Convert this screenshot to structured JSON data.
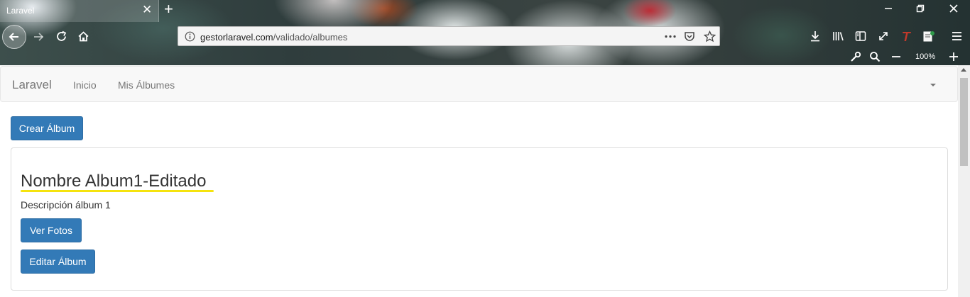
{
  "browser": {
    "tab_title": "Laravel",
    "url_domain": "gestorlaravel.com",
    "url_path": "/validado/albumes",
    "zoom": "100%",
    "icons": [
      "back-icon",
      "forward-icon",
      "reload-icon",
      "home-icon",
      "info-icon",
      "more-icon",
      "pocket-icon",
      "star-icon",
      "download-icon",
      "library-icon",
      "sidebar-icon",
      "fullscreen-icon",
      "extension-t-icon",
      "extension-reader-icon",
      "menu-icon",
      "wrench-icon",
      "zoom-search-icon",
      "zoom-out-icon",
      "zoom-in-icon",
      "minimize-icon",
      "restore-icon",
      "close-icon"
    ]
  },
  "navbar": {
    "brand": "Laravel",
    "links": [
      "Inicio",
      "Mis Álbumes"
    ]
  },
  "main": {
    "create_button": "Crear Álbum",
    "album": {
      "title": "Nombre Album1-Editado",
      "description": "Descripción álbum 1",
      "view_button": "Ver Fotos",
      "edit_button": "Editar Álbum"
    }
  },
  "colors": {
    "primary": "#337ab7",
    "highlight": "#f5e30e"
  }
}
